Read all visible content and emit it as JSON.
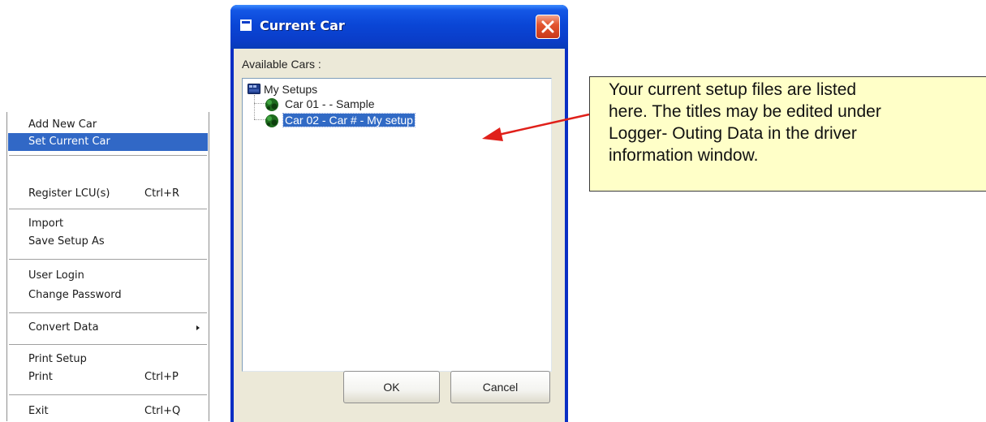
{
  "menu": {
    "items": [
      {
        "label": "Add New Car",
        "shortcut": ""
      },
      {
        "label": "Set Current Car",
        "shortcut": ""
      },
      {
        "label": "Register LCU(s)",
        "shortcut": "Ctrl+R"
      },
      {
        "label": "Import",
        "shortcut": ""
      },
      {
        "label": "Save Setup As",
        "shortcut": ""
      },
      {
        "label": "User Login",
        "shortcut": ""
      },
      {
        "label": "Change Password",
        "shortcut": ""
      },
      {
        "label": "Convert Data",
        "shortcut": ""
      },
      {
        "label": "Print Setup",
        "shortcut": ""
      },
      {
        "label": "Print",
        "shortcut": "Ctrl+P"
      },
      {
        "label": "Exit",
        "shortcut": "Ctrl+Q"
      }
    ],
    "selected": "Set Current Car",
    "submenu_arrow_icon": "chevron-right-icon"
  },
  "dialog": {
    "title": "Current Car",
    "title_icon": "window-icon",
    "close_icon": "close-icon",
    "available_label": "Available Cars :",
    "tree": {
      "root": "My Setups",
      "root_icon": "folder-icon",
      "items": [
        {
          "label": "Car 01 -  - Sample",
          "icon": "car-icon"
        },
        {
          "label": "Car 02 - Car # - My setup",
          "icon": "car-icon",
          "selected": true
        }
      ]
    },
    "buttons": {
      "ok": "OK",
      "cancel": "Cancel"
    }
  },
  "callout": {
    "lines": [
      "Your current setup files are listed",
      "here. The titles may be edited under",
      "Logger- Outing Data in the driver",
      "information window."
    ],
    "color": "#ffffc8",
    "arrow_color": "#e0201a"
  }
}
